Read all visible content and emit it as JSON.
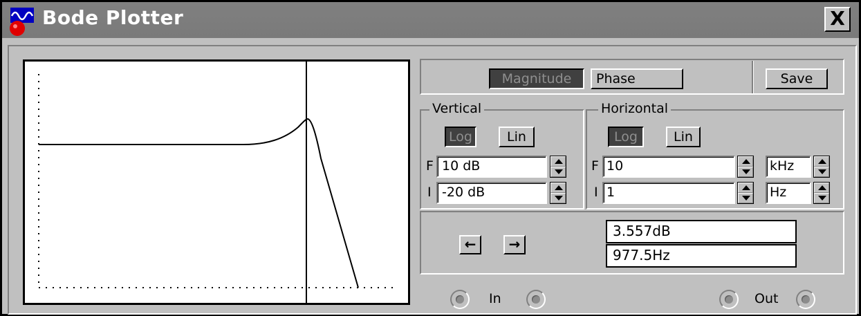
{
  "window": {
    "title": "Bode Plotter",
    "close_label": "X"
  },
  "mode": {
    "magnitude_label": "Magnitude",
    "phase_label": "Phase",
    "save_label": "Save",
    "active": "Magnitude"
  },
  "vertical": {
    "group_label": "Vertical",
    "log_label": "Log",
    "lin_label": "Lin",
    "scale": "Log",
    "f_label": "F",
    "f_value": "10 dB",
    "i_label": "I",
    "i_value": "-20 dB"
  },
  "horizontal": {
    "group_label": "Horizontal",
    "log_label": "Log",
    "lin_label": "Lin",
    "scale": "Log",
    "f_label": "F",
    "f_value": "10",
    "f_unit": "kHz",
    "i_label": "I",
    "i_value": "1",
    "i_unit": "Hz"
  },
  "cursor": {
    "left_label": "←",
    "right_label": "→",
    "magnitude_readout": "3.557dB",
    "frequency_readout": "977.5Hz"
  },
  "terminals": {
    "in_label": "In",
    "out_label": "Out"
  },
  "colors": {
    "titlebar": "#808080",
    "face": "#c0c0c0",
    "pressed": "#404040",
    "plot_bg": "#ffffff",
    "trace": "#000000"
  },
  "icons": {
    "app": "bode-plotter-icon",
    "close": "close-icon",
    "spin": "spin-arrows-icon",
    "terminal": "terminal-icon"
  }
}
